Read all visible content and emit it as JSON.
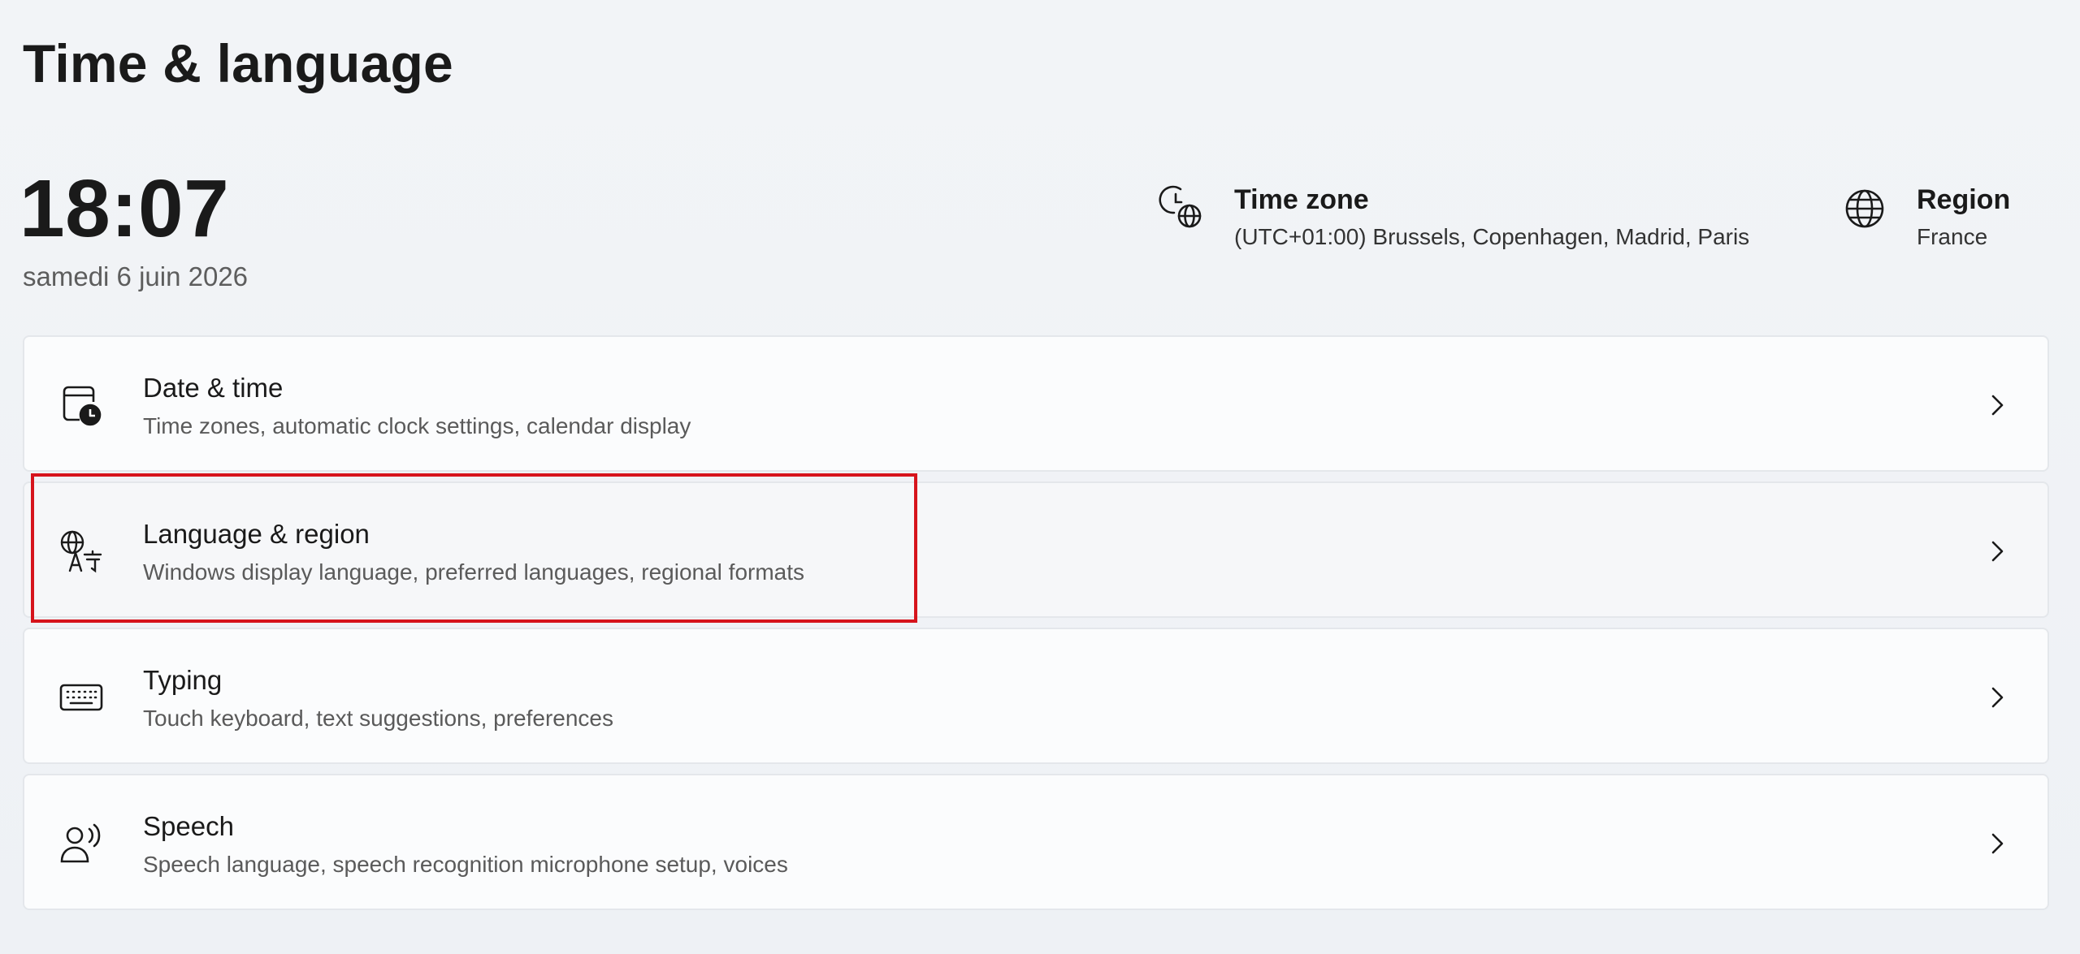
{
  "page": {
    "title": "Time & language"
  },
  "clock": {
    "time": "18:07",
    "date": "samedi 6 juin 2026"
  },
  "timezone": {
    "title": "Time zone",
    "value": "(UTC+01:00) Brussels, Copenhagen, Madrid, Paris",
    "icon": "clock-globe-icon"
  },
  "region": {
    "title": "Region",
    "value": "France",
    "icon": "globe-icon"
  },
  "cards": [
    {
      "title": "Date & time",
      "description": "Time zones, automatic clock settings, calendar display",
      "icon": "calendar-clock-icon"
    },
    {
      "title": "Language & region",
      "description": "Windows display language, preferred languages, regional formats",
      "icon": "language-icon"
    },
    {
      "title": "Typing",
      "description": "Touch keyboard, text suggestions, preferences",
      "icon": "keyboard-icon"
    },
    {
      "title": "Speech",
      "description": "Speech language, speech recognition microphone setup, voices",
      "icon": "speech-icon"
    }
  ],
  "colors": {
    "highlight_border": "#d6141c",
    "card_background": "#fbfcfd",
    "page_background": "#f2f4f7"
  }
}
